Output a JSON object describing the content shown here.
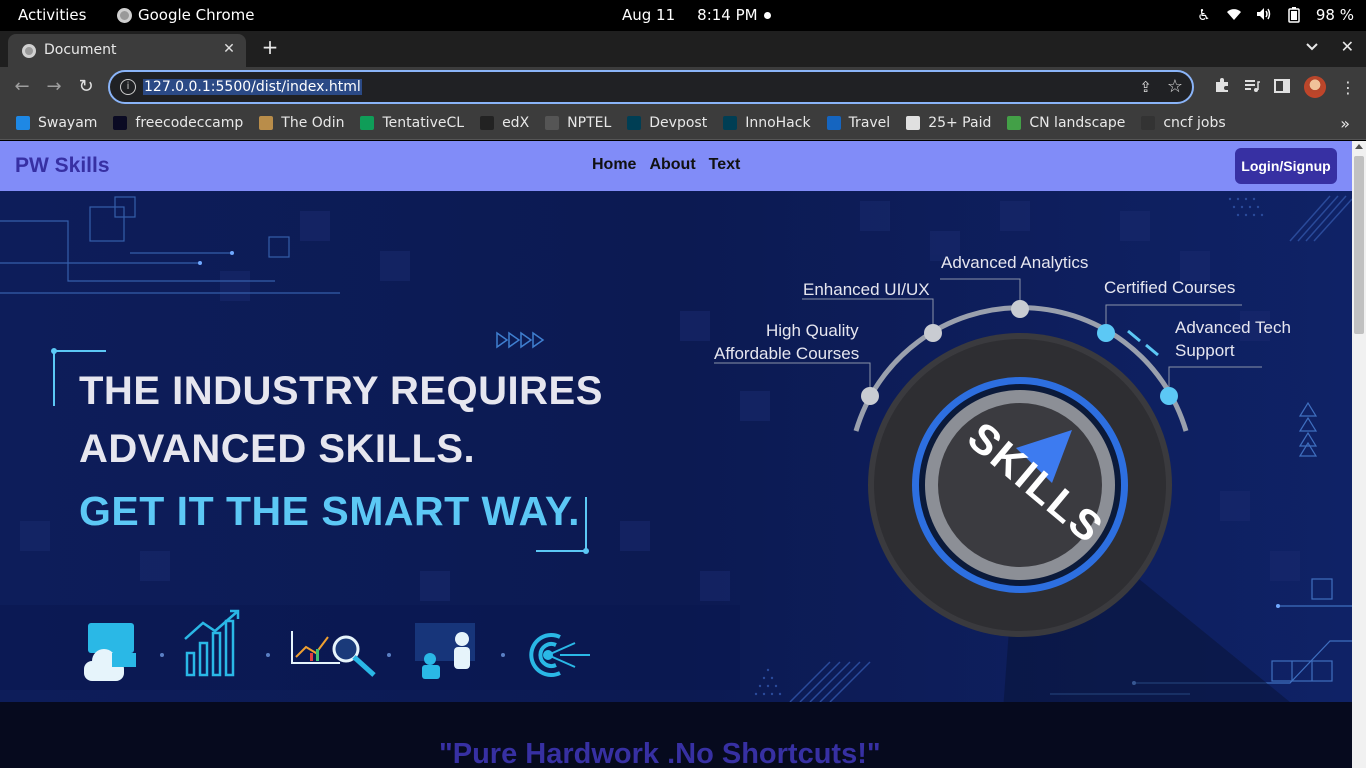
{
  "system": {
    "activities": "Activities",
    "app_name": "Google Chrome",
    "date": "Aug 11",
    "time": "8:14 PM",
    "battery": "98 %"
  },
  "browser": {
    "tab_title": "Document",
    "url": "127.0.0.1:5500/dist/index.html",
    "bookmarks": [
      {
        "label": "Swayam",
        "icon": "swayam-icon",
        "color": "#1e88e5"
      },
      {
        "label": "freecodeccamp",
        "icon": "freecodecamp-icon",
        "color": "#0a0a23"
      },
      {
        "label": "The Odin",
        "icon": "odin-icon",
        "color": "#b98d4a"
      },
      {
        "label": "TentativeCL",
        "icon": "sheets-icon",
        "color": "#0f9d58"
      },
      {
        "label": "edX",
        "icon": "edx-icon",
        "color": "#222222"
      },
      {
        "label": "NPTEL",
        "icon": "nptel-icon",
        "color": "#555555"
      },
      {
        "label": "Devpost",
        "icon": "devpost-icon",
        "color": "#003e54"
      },
      {
        "label": "InnoHack",
        "icon": "devpost-icon",
        "color": "#003e54"
      },
      {
        "label": "Travel",
        "icon": "travel-icon",
        "color": "#1565c0"
      },
      {
        "label": "25+ Paid",
        "icon": "doc-icon",
        "color": "#e0e0e0"
      },
      {
        "label": "CN landscape",
        "icon": "landscape-icon",
        "color": "#43a047"
      },
      {
        "label": "cncf jobs",
        "icon": "cncf-icon",
        "color": "#333333"
      }
    ]
  },
  "site": {
    "brand": "PW Skills",
    "nav": [
      "Home",
      "About",
      "Text"
    ],
    "login_label": "Login/Signup",
    "hero": {
      "line1": "THE INDUSTRY REQUIRES",
      "line2": "ADVANCED SKILLS.",
      "line3": "GET IT THE SMART WAY.",
      "knob": "SKILLS",
      "labels": {
        "analytics": "Advanced Analytics",
        "uiux": "Enhanced UI/UX",
        "certified": "Certified Courses",
        "quality_1": "High Quality",
        "quality_2": "Affordable Courses",
        "tech_1": "Advanced Tech",
        "tech_2": "Support"
      }
    },
    "quote": "\"Pure Hardwork .No Shortcuts!\""
  },
  "colors": {
    "nav_bg": "#818cf8",
    "brand": "#3730a3",
    "accent_cyan": "#5cc8f5",
    "hero_bg": "#0d1d5a"
  }
}
